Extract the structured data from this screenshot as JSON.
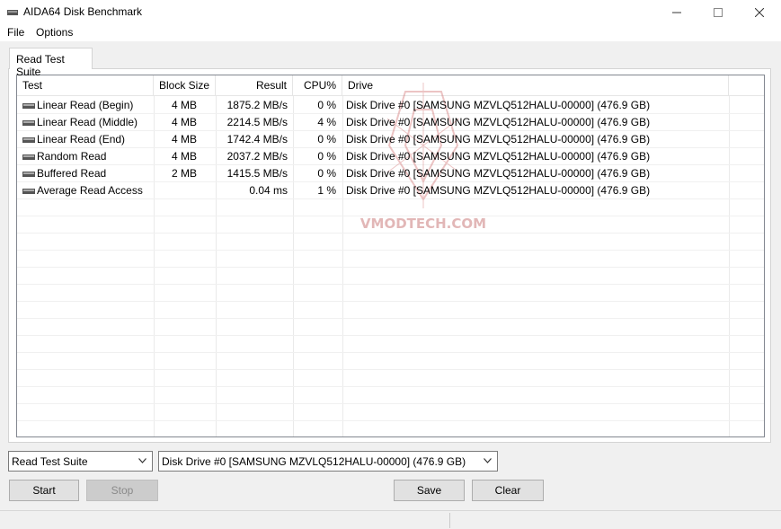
{
  "window": {
    "title": "AIDA64 Disk Benchmark",
    "controls": {
      "minimize": "—",
      "maximize": "☐",
      "close": "✕"
    }
  },
  "menu": {
    "file": "File",
    "options": "Options"
  },
  "tab": {
    "label": "Read Test Suite"
  },
  "table": {
    "headers": {
      "test": "Test",
      "block_size": "Block Size",
      "result": "Result",
      "cpu": "CPU%",
      "drive": "Drive"
    },
    "rows": [
      {
        "test": "Linear Read (Begin)",
        "block_size": "4 MB",
        "result": "1875.2 MB/s",
        "cpu": "0 %",
        "drive": "Disk Drive #0  [SAMSUNG MZVLQ512HALU-00000]  (476.9 GB)"
      },
      {
        "test": "Linear Read (Middle)",
        "block_size": "4 MB",
        "result": "2214.5 MB/s",
        "cpu": "4 %",
        "drive": "Disk Drive #0  [SAMSUNG MZVLQ512HALU-00000]  (476.9 GB)"
      },
      {
        "test": "Linear Read (End)",
        "block_size": "4 MB",
        "result": "1742.4 MB/s",
        "cpu": "0 %",
        "drive": "Disk Drive #0  [SAMSUNG MZVLQ512HALU-00000]  (476.9 GB)"
      },
      {
        "test": "Random Read",
        "block_size": "4 MB",
        "result": "2037.2 MB/s",
        "cpu": "0 %",
        "drive": "Disk Drive #0  [SAMSUNG MZVLQ512HALU-00000]  (476.9 GB)"
      },
      {
        "test": "Buffered Read",
        "block_size": "2 MB",
        "result": "1415.5 MB/s",
        "cpu": "0 %",
        "drive": "Disk Drive #0  [SAMSUNG MZVLQ512HALU-00000]  (476.9 GB)"
      },
      {
        "test": "Average Read Access",
        "block_size": "",
        "result": "0.04 ms",
        "cpu": "1 %",
        "drive": "Disk Drive #0  [SAMSUNG MZVLQ512HALU-00000]  (476.9 GB)"
      }
    ]
  },
  "watermark": {
    "text": "VMODTECH.COM"
  },
  "controls": {
    "suite_select": "Read Test Suite",
    "drive_select": "Disk Drive #0  [SAMSUNG MZVLQ512HALU-00000]  (476.9 GB)",
    "start": "Start",
    "stop": "Stop",
    "save": "Save",
    "clear": "Clear"
  },
  "icons": {
    "app": "disk-drive-icon",
    "row": "disk-drive-icon",
    "dropdown": "chevron-down-icon"
  },
  "colors": {
    "window_bg": "#f0f0f0",
    "panel_bg": "#ffffff",
    "watermark_red": "#d8a0a0"
  }
}
